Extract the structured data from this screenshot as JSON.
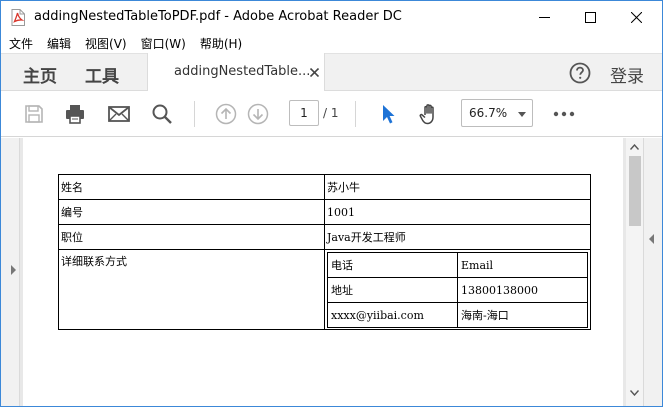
{
  "window": {
    "title": "addingNestedTableToPDF.pdf - Adobe Acrobat Reader DC"
  },
  "menu": {
    "items": [
      "文件",
      "编辑",
      "视图(V)",
      "窗口(W)",
      "帮助(H)"
    ]
  },
  "tabs": {
    "home_label": "主页",
    "tools_label": "工具",
    "document_label": "addingNestedTable...",
    "login_label": "登录"
  },
  "toolbar": {
    "current_page": "1",
    "page_total": "/ 1",
    "zoom": "66.7%"
  },
  "document": {
    "rows": [
      {
        "label": "姓名",
        "value": "苏小牛"
      },
      {
        "label": "编号",
        "value": "1001"
      },
      {
        "label": "职位",
        "value": "Java开发工程师"
      }
    ],
    "contact_label": "详细联系方式",
    "contact_table": [
      [
        "电话",
        "Email"
      ],
      [
        "地址",
        "13800138000"
      ],
      [
        "xxxx@yiibai.com",
        "海南-海口"
      ]
    ]
  },
  "colors": {
    "accent_blue": "#1e73d6",
    "window_border": "#3c88d8",
    "pdf_icon_red": "#d8342a"
  }
}
